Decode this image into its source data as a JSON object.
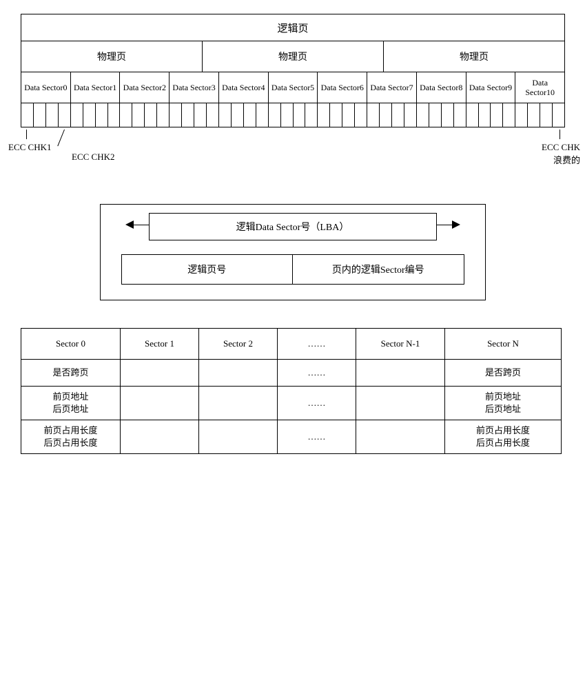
{
  "d1": {
    "logical_page": "逻辑页",
    "physical_pages": [
      "物理页",
      "物理页",
      "物理页"
    ],
    "sectors": [
      "Data Sector0",
      "Data Sector1",
      "Data Sector2",
      "Data Sector3",
      "Data Sector4",
      "Data Sector5",
      "Data Sector6",
      "Data Sector7",
      "Data Sector8",
      "Data Sector9",
      "Data Sector10"
    ],
    "ecc1": "ECC CHK1",
    "ecc2": "ECC CHK2",
    "ecc_wasted_l1": "ECC CHK",
    "ecc_wasted_l2": "浪费的"
  },
  "d2": {
    "lba": "逻辑Data Sector号（LBA）",
    "logical_page_no": "逻辑页号",
    "intra_page_sector_no": "页内的逻辑Sector编号"
  },
  "d3": {
    "headers": [
      "Sector 0",
      "Sector 1",
      "Sector 2",
      "……",
      "Sector N-1",
      "Sector N"
    ],
    "row_cross_label": "是否跨页",
    "row_addr_l1": "前页地址",
    "row_addr_l2": "后页地址",
    "row_len_l1": "前页占用长度",
    "row_len_l2": "后页占用长度",
    "ellipsis": "……"
  }
}
